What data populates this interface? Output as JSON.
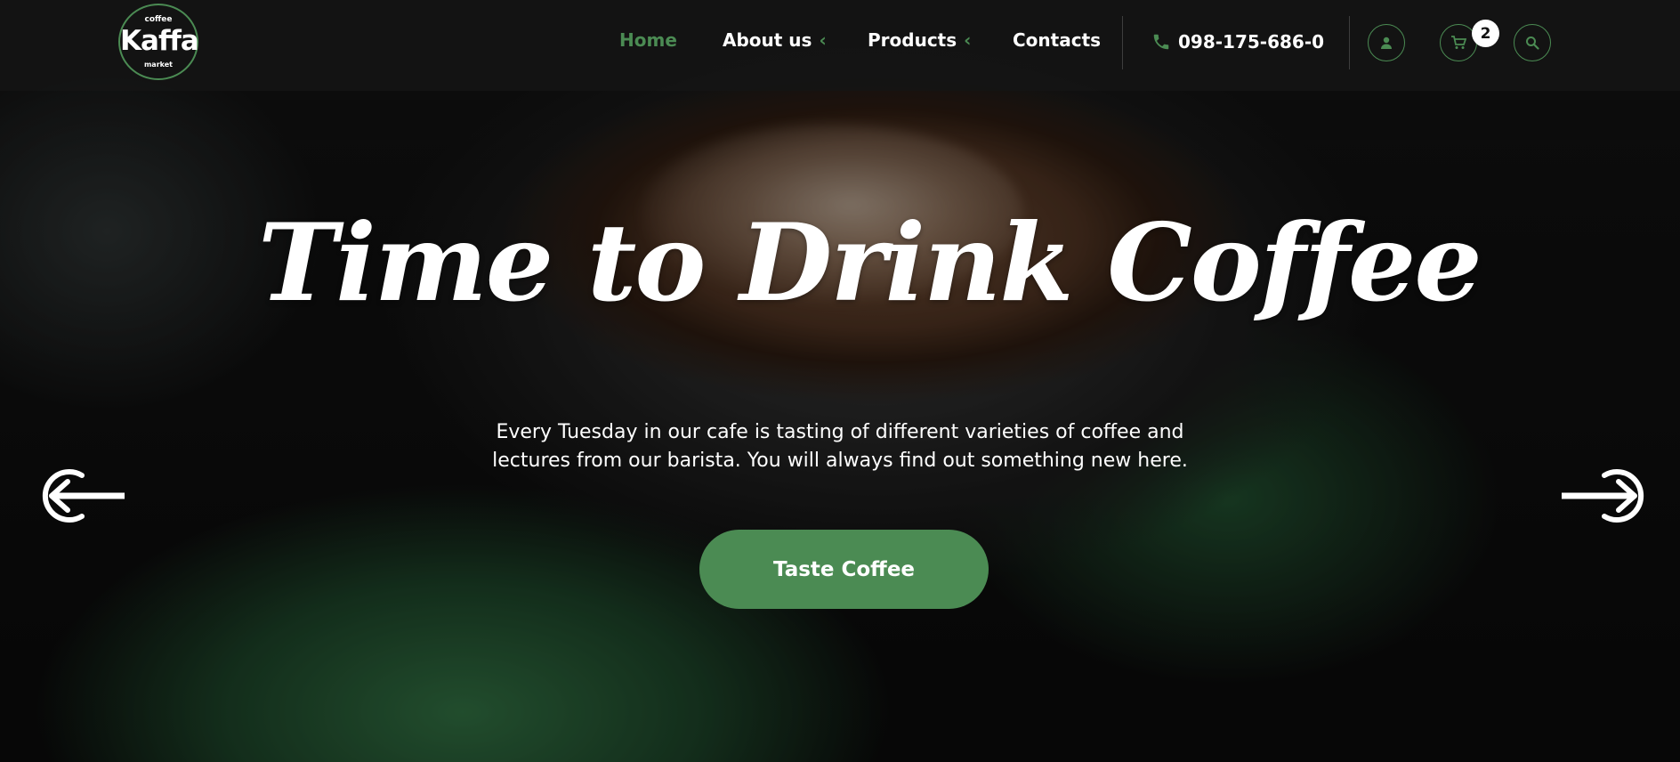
{
  "brand": {
    "logo_top": "coffee",
    "logo_main": "Kaffa",
    "logo_bottom": "market",
    "accent_color": "#4b8b53"
  },
  "nav": {
    "items": [
      {
        "label": "Home",
        "active": true
      },
      {
        "label": "About us",
        "has_submenu": true
      },
      {
        "label": "Products",
        "has_submenu": true
      },
      {
        "label": "Contacts"
      }
    ]
  },
  "header": {
    "phone": "098-175-686-0",
    "phone_icon": "phone-icon",
    "account_icon": "user-icon",
    "cart_icon": "cart-icon",
    "cart_count": "2",
    "search_icon": "search-icon"
  },
  "hero": {
    "title": "Time to Drink Coffee",
    "text": "Every Tuesday in our cafe is tasting of different varieties of coffee and lectures from our barista. You will always find out something new here.",
    "cta_label": "Taste Coffee",
    "prev_icon": "arrow-left-icon",
    "next_icon": "arrow-right-icon"
  }
}
